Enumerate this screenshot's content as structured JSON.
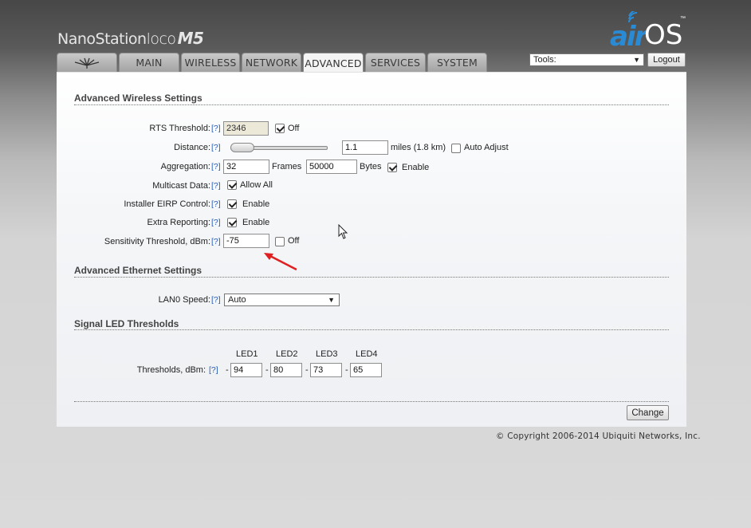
{
  "header": {
    "product_name": "NanoStation",
    "product_model": "loco",
    "product_variant": "M5",
    "brand_air": "air",
    "brand_os": "OS",
    "brand_tm": "™"
  },
  "tabs": [
    {
      "label": "",
      "icon": "ubiquiti-logo-icon"
    },
    {
      "label": "MAIN"
    },
    {
      "label": "WIRELESS"
    },
    {
      "label": "NETWORK"
    },
    {
      "label": "ADVANCED",
      "active": true
    },
    {
      "label": "SERVICES"
    },
    {
      "label": "SYSTEM"
    }
  ],
  "tools": {
    "selected": "Tools:"
  },
  "logout_label": "Logout",
  "wireless": {
    "title": "Advanced Wireless Settings",
    "help": "[?]",
    "rts": {
      "label": "RTS Threshold:",
      "value": "2346",
      "off_label": "Off",
      "off_checked": true
    },
    "distance": {
      "label": "Distance:",
      "value": "1.1",
      "unit": "miles (1.8 km)",
      "auto_label": "Auto Adjust",
      "auto_checked": false
    },
    "aggregation": {
      "label": "Aggregation:",
      "frames": "32",
      "frames_label": "Frames",
      "bytes": "50000",
      "bytes_label": "Bytes",
      "enable_label": "Enable",
      "enabled": true
    },
    "multicast": {
      "label": "Multicast Data:",
      "allow_label": "Allow All",
      "checked": true
    },
    "eirp": {
      "label": "Installer EIRP Control:",
      "enable_label": "Enable",
      "checked": true
    },
    "extra": {
      "label": "Extra Reporting:",
      "enable_label": "Enable",
      "checked": true
    },
    "sensitivity": {
      "label": "Sensitivity Threshold, dBm:",
      "value": "-75",
      "off_label": "Off",
      "off_checked": false
    }
  },
  "ethernet": {
    "title": "Advanced Ethernet Settings",
    "lan0": {
      "label": "LAN0 Speed:",
      "value": "Auto"
    }
  },
  "led": {
    "title": "Signal LED Thresholds",
    "headers": [
      "LED1",
      "LED2",
      "LED3",
      "LED4"
    ],
    "label": "Thresholds, dBm:",
    "dash": "-",
    "values": [
      "94",
      "80",
      "73",
      "65"
    ]
  },
  "change_label": "Change",
  "copyright": "© Copyright 2006-2014 Ubiquiti Networks, Inc.",
  "colors": {
    "accent": "#2a8ad4",
    "help_link": "#2a60b8",
    "annotation_arrow": "#e02020"
  }
}
